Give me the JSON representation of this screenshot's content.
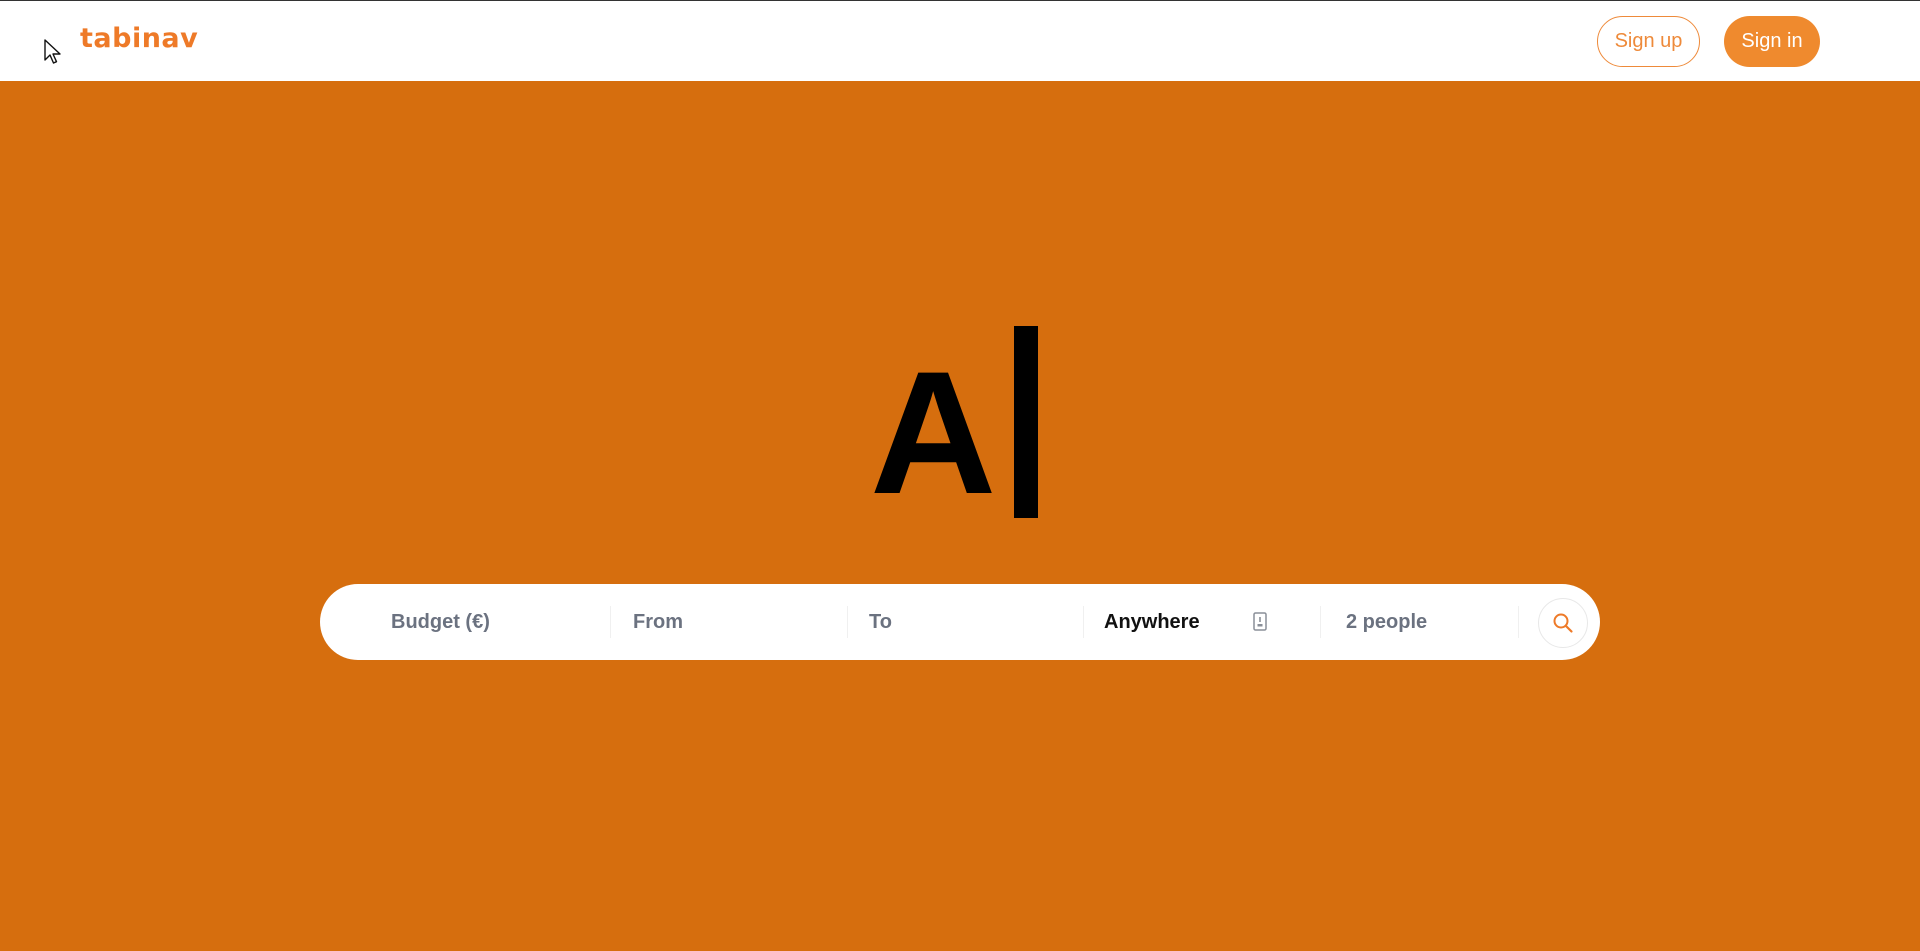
{
  "header": {
    "logo_text": "tabinav",
    "signup_label": "Sign up",
    "signin_label": "Sign in"
  },
  "hero": {
    "title_text": "A"
  },
  "search": {
    "budget_label": "Budget (€)",
    "from_label": "From",
    "to_label": "To",
    "destination_value": "Anywhere",
    "travellers_value": "2 people",
    "search_icon": "search-icon",
    "destination_icon": "book-icon"
  },
  "colors": {
    "brand": "#ee7a28",
    "hero_background": "#d66e0e",
    "signin_background": "#ef8a2e"
  }
}
